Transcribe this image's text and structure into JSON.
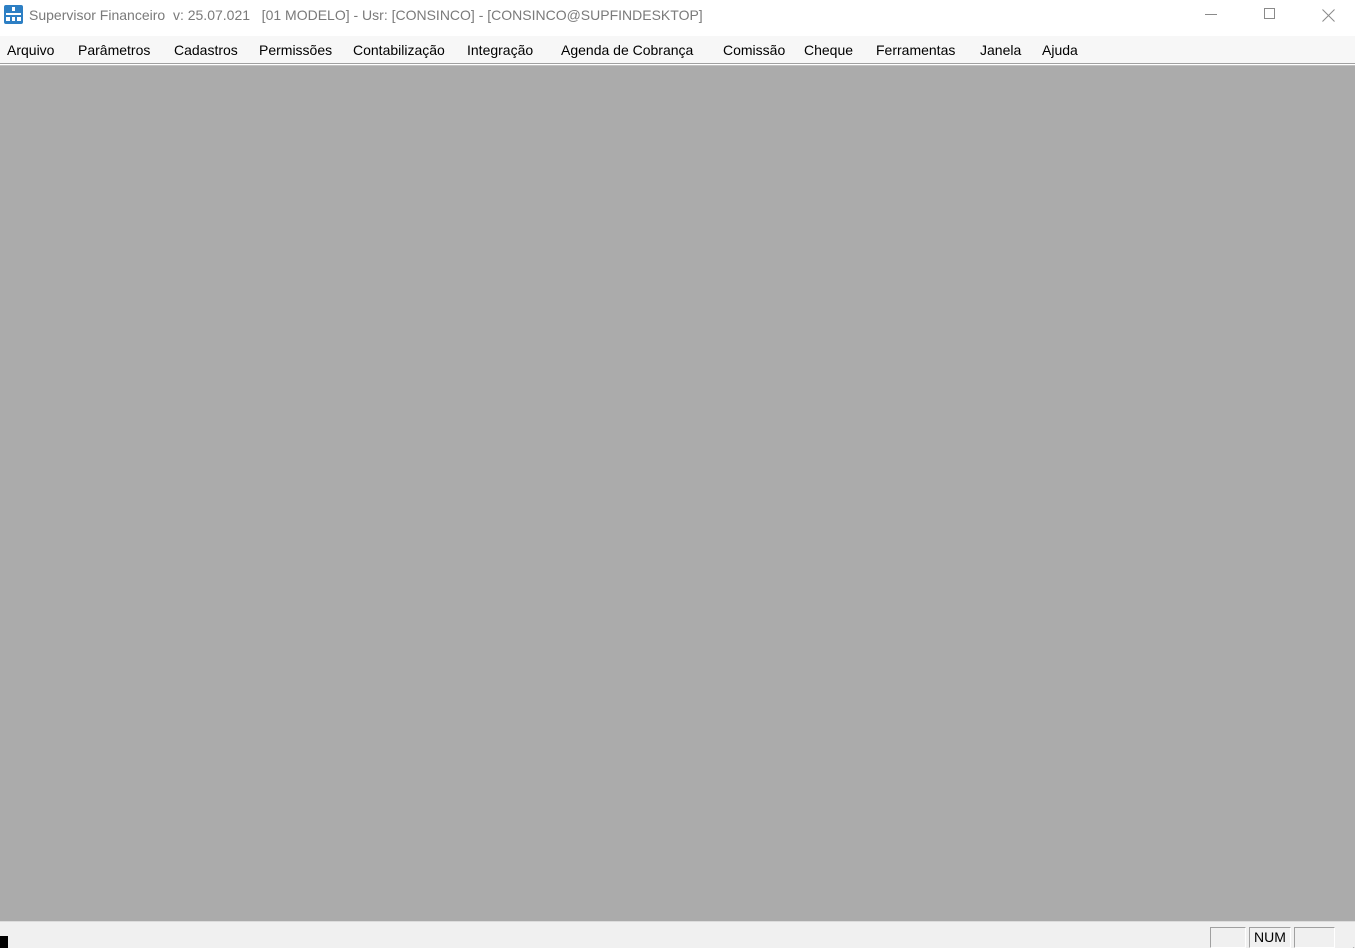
{
  "window": {
    "title": "Supervisor Financeiro  v: 25.07.021   [01 MODELO] - Usr: [CONSINCO] - [CONSINCO@SUPFINDESKTOP]",
    "app_icon": "app-icon",
    "controls": {
      "minimize_icon": "minimize-icon",
      "maximize_icon": "maximize-icon",
      "close_icon": "close-icon"
    }
  },
  "menu": {
    "items": [
      {
        "label": "Arquivo"
      },
      {
        "label": "Parâmetros"
      },
      {
        "label": "Cadastros"
      },
      {
        "label": "Permissões"
      },
      {
        "label": "Contabilização"
      },
      {
        "label": "Integração"
      },
      {
        "label": "Agenda de Cobrança"
      },
      {
        "label": "Comissão"
      },
      {
        "label": "Cheque"
      },
      {
        "label": "Ferramentas"
      },
      {
        "label": "Janela"
      },
      {
        "label": "Ajuda"
      }
    ]
  },
  "statusbar": {
    "panel1": "",
    "panel2": "NUM",
    "panel3": ""
  },
  "colors": {
    "workspace": "#ababab",
    "menubar": "#f7f7f7",
    "titlebar": "#ffffff",
    "icon_accent": "#2d7fc4"
  }
}
